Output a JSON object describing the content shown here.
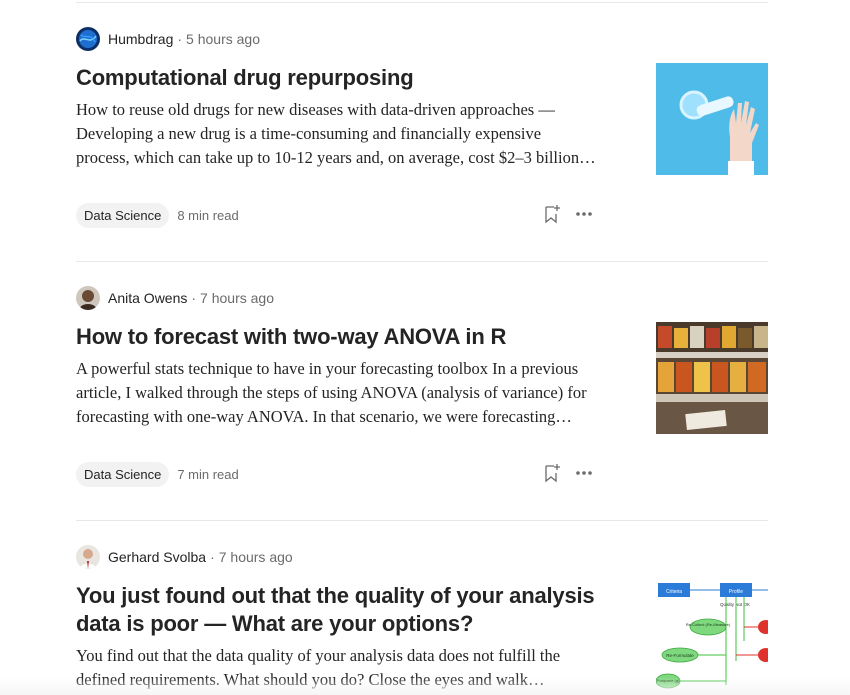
{
  "articles": [
    {
      "author": "Humbdrag",
      "time": "5 hours ago",
      "title": "Computational drug repurposing",
      "excerpt": "How to reuse old drugs for new diseases with data-driven approaches — Developing a new drug is a time-consuming and financially expensive process, which can take up to 10-12 years and, on average, cost $2–3 billion…",
      "tag": "Data Science",
      "read_time": "8 min read",
      "thumbnail_icon": "pills-and-hand-photo"
    },
    {
      "author": "Anita Owens",
      "time": "7 hours ago",
      "title": "How to forecast with two-way ANOVA in R",
      "excerpt": "A powerful stats technique to have in your forecasting toolbox In a previous article, I walked through the steps of using ANOVA (analysis of variance) for forecasting with one-way ANOVA. In that scenario, we were forecasting…",
      "tag": "Data Science",
      "read_time": "7 min read",
      "thumbnail_icon": "grocery-shelf-photo"
    },
    {
      "author": "Gerhard Svolba",
      "time": "7 hours ago",
      "title": "You just found out that the quality of your analysis data is poor — What are your options?",
      "excerpt": "You find out that the data quality of your analysis data does not fulfill the defined requirements. What should you do? Close the eyes and walk…",
      "tag": "",
      "read_time": "",
      "thumbnail_icon": "flowchart-diagram"
    }
  ],
  "separator": "·",
  "thumbnail3_labels": {
    "box1": "Criteria",
    "box2": "Profile",
    "quality": "Quality Not OK",
    "recollect": "Re-Collect (Re-Measure)",
    "reformulate": "Re-Formulate",
    "postpone": "Postpone (g)"
  },
  "colors": {
    "text": "#242424",
    "muted": "#6b6b6b",
    "tag_bg": "#f2f2f2",
    "divider": "#e8e8e8"
  }
}
